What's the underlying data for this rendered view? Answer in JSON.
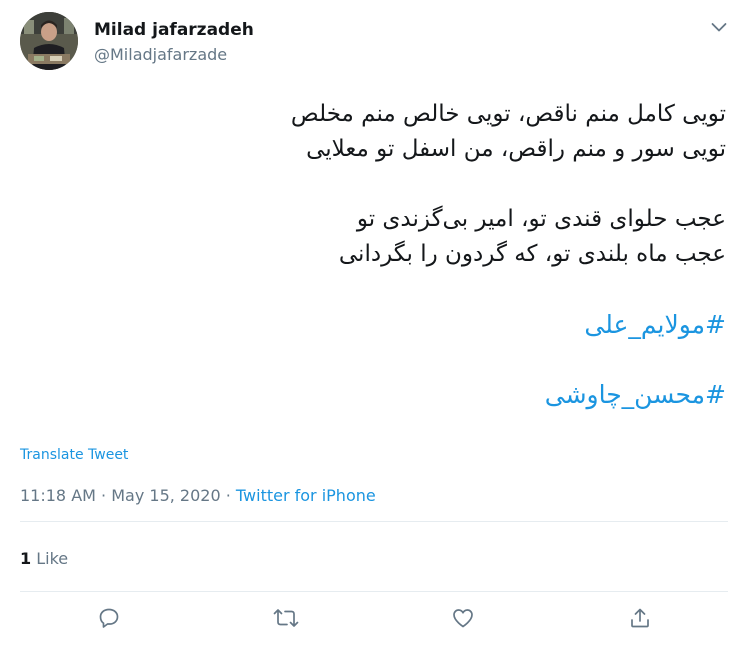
{
  "user": {
    "display_name": "Milad jafarzadeh",
    "handle": "@Miladjafarzade"
  },
  "tweet": {
    "lines": [
      "تویی کامل منم ناقص، تویی خالص منم مخلص",
      "تویی سور و منم راقص، من اسفل تو معلایی",
      "عجب حلوای قندی تو، امیر بی‌گزندی تو",
      "عجب ماه بلندی تو، که گردون را بگردانی"
    ],
    "hashtags": [
      "#مولایم_علی",
      "#محسن_چاوشی"
    ],
    "translate_label": "Translate Tweet"
  },
  "meta": {
    "time": "11:18 AM",
    "separator1": " · ",
    "date": "May 15, 2020",
    "separator2": " · ",
    "source": "Twitter for iPhone"
  },
  "stats": {
    "likes_count": "1",
    "likes_label": " Like"
  },
  "actions": {
    "reply_icon": "reply-icon",
    "retweet_icon": "retweet-icon",
    "like_icon": "heart-icon",
    "share_icon": "share-icon"
  },
  "colors": {
    "link": "#1b95e0",
    "text": "#14171a",
    "secondary": "#657786",
    "divider": "#e6ecf0"
  }
}
